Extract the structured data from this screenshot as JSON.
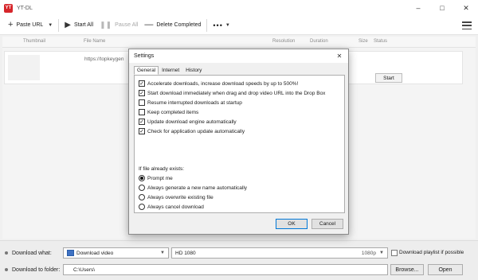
{
  "app": {
    "title": "YT-DL",
    "icon_label": "YT"
  },
  "window_controls": {
    "minimize": "–",
    "maximize": "□",
    "close": "✕"
  },
  "toolbar": {
    "paste_url": "Paste URL",
    "start_all": "Start All",
    "pause_all": "Pause All",
    "delete_completed": "Delete Completed",
    "more": "•••"
  },
  "table": {
    "columns": [
      "Thumbnail",
      "File Name",
      "Resolution",
      "Duration",
      "Size",
      "Status"
    ],
    "row": {
      "url": "https://topkeygen",
      "start_label": "Start"
    }
  },
  "bottom": {
    "download_what_label": "Download what:",
    "download_what_value": "Download video",
    "quality_value": "HD 1080",
    "quality_suffix": "1080p",
    "playlist_label": "Download playlist if possible",
    "download_to_label": "Download to folder:",
    "folder_value": "C:\\Users\\",
    "browse_label": "Browse...",
    "open_label": "Open"
  },
  "dialog": {
    "title": "Settings",
    "tabs": [
      "General",
      "Internet",
      "History"
    ],
    "active_tab": "General",
    "checkboxes": [
      {
        "label": "Accelerate downloads, increase download speeds by up to 500%!",
        "checked": true
      },
      {
        "label": "Start download immediately when drag and drop video URL into the Drop Box",
        "checked": true
      },
      {
        "label": "Resume interrupted downloads at startup",
        "checked": false
      },
      {
        "label": "Keep completed items",
        "checked": false
      },
      {
        "label": "Update download engine automatically",
        "checked": true
      },
      {
        "label": "Check for application update automatically",
        "checked": true
      }
    ],
    "group_label": "If file already exists:",
    "radios": [
      {
        "label": "Prompt me",
        "selected": true
      },
      {
        "label": "Always generate a new name automatically",
        "selected": false
      },
      {
        "label": "Always overwrite existing file",
        "selected": false
      },
      {
        "label": "Always cancel download",
        "selected": false
      }
    ],
    "ok_label": "OK",
    "cancel_label": "Cancel"
  },
  "colors": {
    "accent": "#0078d7",
    "app_icon": "#d6262b",
    "film_icon": "#3f72c3"
  }
}
